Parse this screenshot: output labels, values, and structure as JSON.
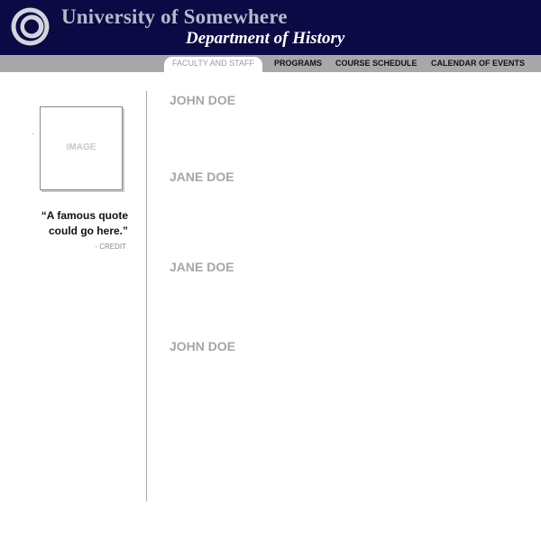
{
  "header": {
    "university": "University of Somewhere",
    "department": "Department of History",
    "logo_icon": "ring-logo-icon"
  },
  "nav": {
    "items": [
      {
        "label": "FACULTY AND STAFF",
        "active": true
      },
      {
        "label": "PROGRAMS",
        "active": false
      },
      {
        "label": "COURSE SCHEDULE",
        "active": false
      },
      {
        "label": "CALENDAR OF EVENTS",
        "active": false
      }
    ]
  },
  "sidebar": {
    "image_label": "IMAGE",
    "quote_line1": "“A famous quote",
    "quote_line2": "could go here.”",
    "credit": "- CREDIT"
  },
  "staff": [
    {
      "name": "JOHN DOE"
    },
    {
      "name": "JANE DOE"
    },
    {
      "name": "JANE DOE"
    },
    {
      "name": "JOHN DOE"
    }
  ],
  "colors": {
    "header_bg": "#0b0a45",
    "nav_bg": "#a8a8a8",
    "name_text": "#a6a6a6"
  }
}
